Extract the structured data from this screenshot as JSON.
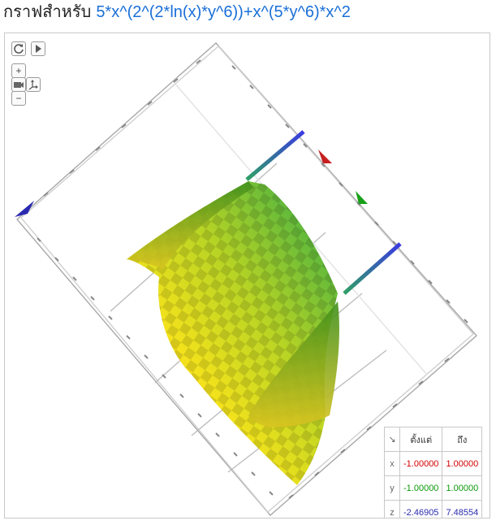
{
  "header": {
    "title_prefix": "กราฟสำหรับ",
    "expression": "5*x^(2^(2*ln(x)*y^6))+x^(5*y^6)*x^2"
  },
  "controls": {
    "reset_icon": "rotate-reset-icon",
    "play_icon": "play-icon",
    "zoom_in_label": "+",
    "zoom_out_label": "−",
    "camera_icon": "camera-icon",
    "axes_icon": "axes-icon"
  },
  "range_table": {
    "corner_icon": "↘",
    "from_header": "ตั้งแต่",
    "to_header": "ถึง",
    "rows": [
      {
        "axis": "x",
        "from": "-1.00000",
        "to": "1.00000"
      },
      {
        "axis": "y",
        "from": "-1.00000",
        "to": "1.00000"
      },
      {
        "axis": "z",
        "from": "-2.46905",
        "to": "7.48554"
      }
    ]
  },
  "colors": {
    "x_axis": "#d20000",
    "y_axis": "#0a9a0a",
    "z_axis": "#2a2ab0",
    "expression": "#1a6fd8"
  }
}
